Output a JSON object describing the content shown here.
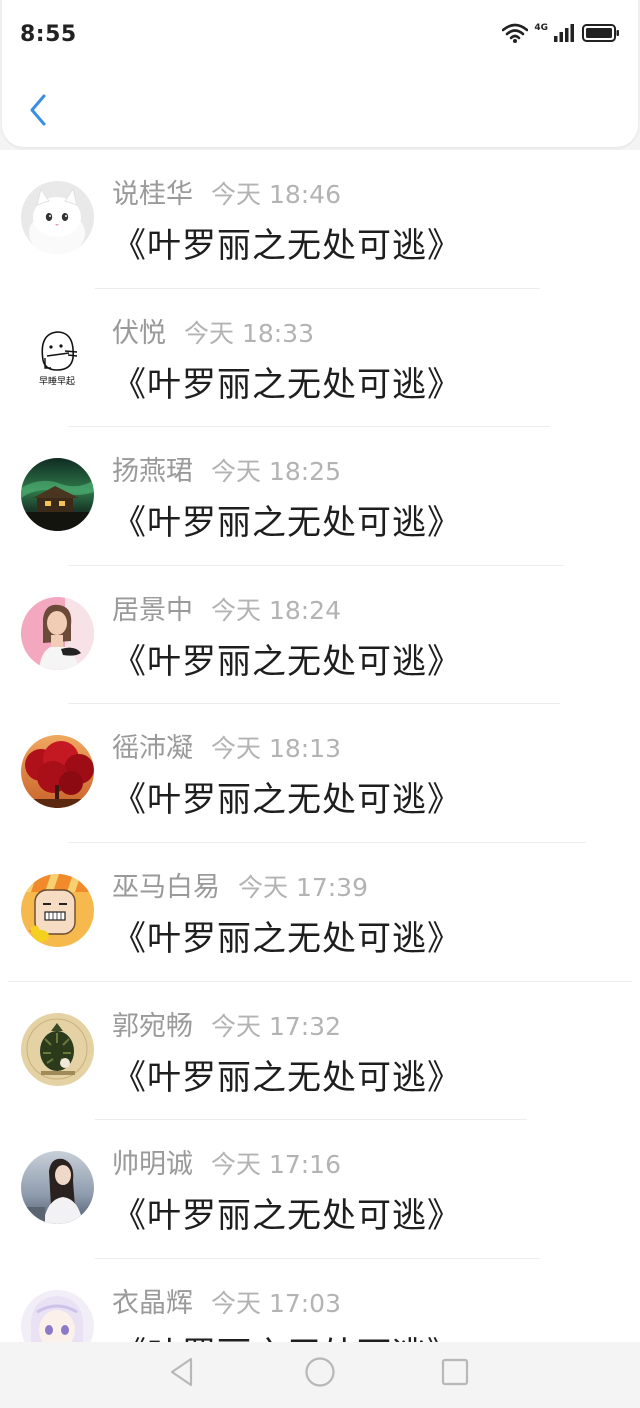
{
  "status_bar": {
    "time": "8:55",
    "network": "4G",
    "icons": [
      "wifi-icon",
      "signal-icon",
      "battery-icon"
    ]
  },
  "header": {
    "back_icon": "chevron-left-icon",
    "accent_color": "#3a8ee6"
  },
  "list": {
    "items": [
      {
        "name": "说桂华",
        "time": "今天 18:46",
        "message": "《叶罗丽之无处可逃》",
        "avatar": "white-cat"
      },
      {
        "name": "伏悦",
        "time": "今天 18:33",
        "message": "《叶罗丽之无处可逃》",
        "avatar": "sketch-cartoon",
        "avatar_text": "早睡早起"
      },
      {
        "name": "扬燕珺",
        "time": "今天 18:25",
        "message": "《叶罗丽之无处可逃》",
        "avatar": "aurora-house"
      },
      {
        "name": "居景中",
        "time": "今天 18:24",
        "message": "《叶罗丽之无处可逃》",
        "avatar": "girl-pink"
      },
      {
        "name": "徭沛凝",
        "time": "今天 18:13",
        "message": "《叶罗丽之无处可逃》",
        "avatar": "red-tree"
      },
      {
        "name": "巫马白易",
        "time": "今天 17:39",
        "message": "《叶罗丽之无处可逃》",
        "avatar": "cartoon-face"
      },
      {
        "name": "郭宛畅",
        "time": "今天 17:32",
        "message": "《叶罗丽之无处可逃》",
        "avatar": "green-plant"
      },
      {
        "name": "帅明诚",
        "time": "今天 17:16",
        "message": "《叶罗丽之无处可逃》",
        "avatar": "girl-sea"
      },
      {
        "name": "衣晶辉",
        "time": "今天 17:03",
        "message": "《叶罗丽之无处可逃》",
        "avatar": "anime-girl"
      }
    ]
  },
  "nav_bar": {
    "buttons": [
      "back-triangle-icon",
      "home-circle-icon",
      "recents-square-icon"
    ]
  }
}
